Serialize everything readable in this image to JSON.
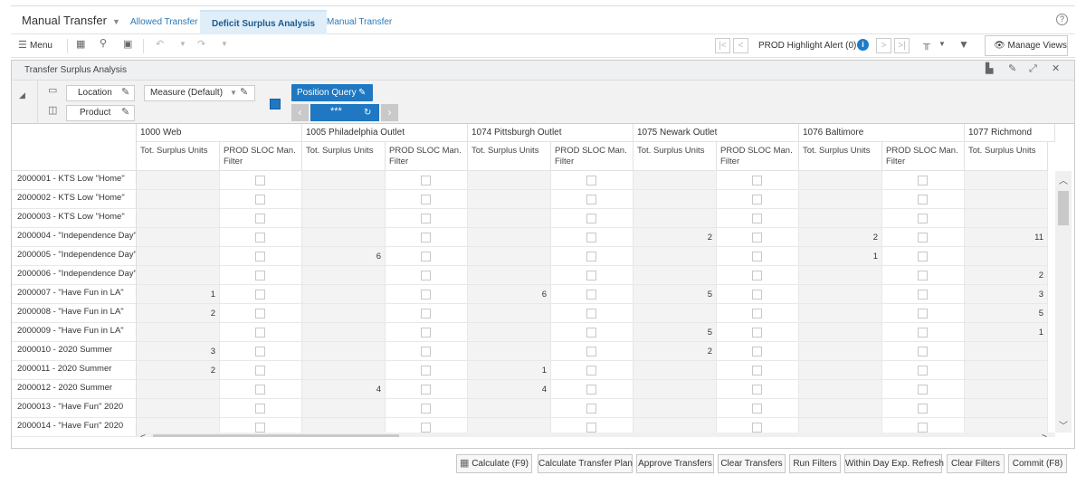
{
  "header": {
    "app_title": "Manual Transfer",
    "tabs": [
      {
        "label": "Allowed Transfer"
      },
      {
        "label": "Deficit Surplus Analysis"
      },
      {
        "label": "Manual Transfer"
      }
    ],
    "help_glyph": "?"
  },
  "toolbar": {
    "menu_label": "Menu",
    "alert_label": "PROD Highlight Alert (0)",
    "manage_views_label": "Manage Views"
  },
  "panel": {
    "title": "Transfer Surplus Analysis",
    "pivot": {
      "location_label": "Location",
      "product_label": "Product",
      "measure_label": "Measure (Default)",
      "position_query_label": "Position Query",
      "position_nav_value": "***"
    }
  },
  "grid": {
    "locations": [
      {
        "name": "1000 Web"
      },
      {
        "name": "1005 Philadelphia Outlet"
      },
      {
        "name": "1074 Pittsburgh Outlet"
      },
      {
        "name": "1075 Newark Outlet"
      },
      {
        "name": "1076 Baltimore"
      },
      {
        "name": "1077 Richmond"
      }
    ],
    "measure_units": "Tot. Surplus Units",
    "measure_filter": "PROD SLOC Man. Filter",
    "rows": [
      {
        "label": "2000001 - KTS Low \"Home\"",
        "values": [
          "",
          "",
          "",
          "",
          "",
          ""
        ]
      },
      {
        "label": "2000002 - KTS Low \"Home\"",
        "values": [
          "",
          "",
          "",
          "",
          "",
          ""
        ]
      },
      {
        "label": "2000003 - KTS Low \"Home\"",
        "values": [
          "",
          "",
          "",
          "",
          "",
          ""
        ]
      },
      {
        "label": "2000004 - \"Independence Day\"",
        "values": [
          "",
          "",
          "",
          "2",
          "2",
          "11"
        ]
      },
      {
        "label": "2000005 - \"Independence Day\"",
        "values": [
          "",
          "6",
          "",
          "",
          "1",
          ""
        ]
      },
      {
        "label": "2000006 - \"Independence Day\"",
        "values": [
          "",
          "",
          "",
          "",
          "",
          "2"
        ]
      },
      {
        "label": "2000007 - \"Have Fun in LA\"",
        "values": [
          "1",
          "",
          "6",
          "5",
          "",
          "3"
        ]
      },
      {
        "label": "2000008 - \"Have Fun in LA\"",
        "values": [
          "2",
          "",
          "",
          "",
          "",
          "5"
        ]
      },
      {
        "label": "2000009 - \"Have Fun in LA\"",
        "values": [
          "",
          "",
          "",
          "5",
          "",
          "1"
        ]
      },
      {
        "label": "2000010 - 2020 Summer",
        "values": [
          "3",
          "",
          "",
          "2",
          "",
          ""
        ]
      },
      {
        "label": "2000011 - 2020 Summer",
        "values": [
          "2",
          "",
          "1",
          "",
          "",
          ""
        ]
      },
      {
        "label": "2000012 - 2020 Summer",
        "values": [
          "",
          "4",
          "4",
          "",
          "",
          ""
        ]
      },
      {
        "label": "2000013 - \"Have Fun\" 2020",
        "values": [
          "",
          "",
          "",
          "",
          "",
          ""
        ]
      },
      {
        "label": "2000014 - \"Have Fun\" 2020",
        "values": [
          "",
          "",
          "",
          "",
          "",
          ""
        ]
      }
    ]
  },
  "actions": [
    {
      "label": "Calculate (F9)"
    },
    {
      "label": "Calculate Transfer Plan"
    },
    {
      "label": "Approve Transfers"
    },
    {
      "label": "Clear Transfers"
    },
    {
      "label": "Run Filters"
    },
    {
      "label": "Within Day Exp. Refresh"
    },
    {
      "label": "Clear Filters"
    },
    {
      "label": "Commit (F8)"
    }
  ],
  "colors": {
    "accent": "#1f78c1",
    "active_tab_bg": "#dfeef9",
    "link": "#2a7ab8"
  }
}
